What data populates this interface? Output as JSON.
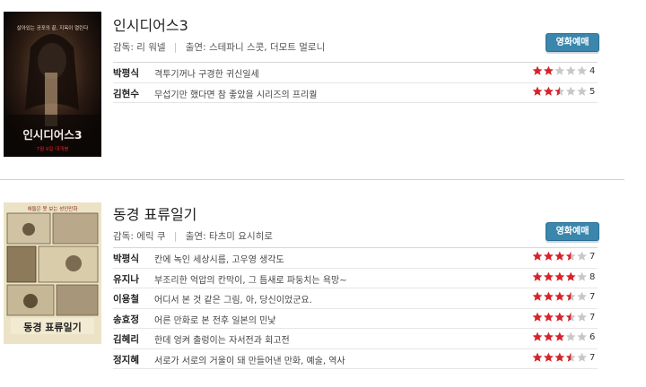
{
  "movies": [
    {
      "title": "인시디어스3",
      "credits": {
        "director_label": "감독:",
        "director": "리 워넬",
        "cast_label": "출연:",
        "cast": "스테파니 스콧, 더모트 멀로니"
      },
      "book_button": "영화예매",
      "poster": {
        "tagline": "살아있는 공포의 끝, 지옥이 열린다",
        "title": "인시디어스3",
        "release": "7월 9일 대개봉"
      },
      "reviews": [
        {
          "name": "박평식",
          "comment": "격투기꺼나 구경한 귀신일세",
          "score": 4
        },
        {
          "name": "김현수",
          "comment": "무섭기만 했다면 참 좋았을 시리즈의 프리퀄",
          "score": 5
        }
      ]
    },
    {
      "title": "동경 표류일기",
      "credits": {
        "director_label": "감독:",
        "director": "에릭 쿠",
        "cast_label": "출연:",
        "cast": "타츠미 요시히로"
      },
      "book_button": "영화예매",
      "poster": {
        "tagline": "애들은 못 보는 성인만화",
        "title": "동경 표류일기"
      },
      "reviews": [
        {
          "name": "박평식",
          "comment": "칸에 녹인 세상시름, 고우영 생각도",
          "score": 7
        },
        {
          "name": "유지나",
          "comment": "부조리한 억압의 칸막이, 그 틈새로 파둥치는 욕망~",
          "score": 8
        },
        {
          "name": "이용철",
          "comment": "어디서 본 것 같은 그림, 아, 당신이었군요.",
          "score": 7
        },
        {
          "name": "송효정",
          "comment": "어른 만화로 본 전후 일본의 민낯",
          "score": 7
        },
        {
          "name": "김혜리",
          "comment": "한데 엉켜 출렁이는 자서전과 회고전",
          "score": 6
        },
        {
          "name": "정지혜",
          "comment": "서로가 서로의 거울이 돼 만들어낸 만화, 예술, 역사",
          "score": 7
        }
      ]
    }
  ],
  "colors": {
    "star_filled": "#d8232a",
    "star_empty": "#c8c8c8",
    "button": "#3a86ad"
  },
  "icons": {
    "star": "star-icon"
  }
}
